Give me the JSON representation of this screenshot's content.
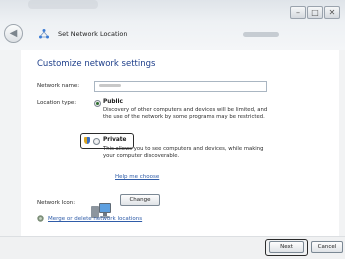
{
  "window": {
    "title": "Set Network Location",
    "controls": [
      "–",
      "□",
      "✕"
    ]
  },
  "main": {
    "heading": "Customize network settings",
    "network_name_label": "Network name:",
    "network_name_value": "Network 3",
    "location_type_label": "Location type:",
    "public": {
      "label": "Public",
      "selected": true,
      "description_line1": "Discovery of other computers and devices will be limited, and",
      "description_line2": "the use of the network by some programs may be restricted."
    },
    "private": {
      "label": "Private",
      "selected": false,
      "description_line1": "This allows you to see computers and devices, while making",
      "description_line2": "your computer discoverable."
    },
    "help_link": "Help me choose",
    "network_icon_label": "Network Icon:",
    "change_button": "Change",
    "merge_link": "Merge or delete network locations"
  },
  "footer": {
    "next_button": "Next",
    "cancel_button": "Cancel"
  }
}
